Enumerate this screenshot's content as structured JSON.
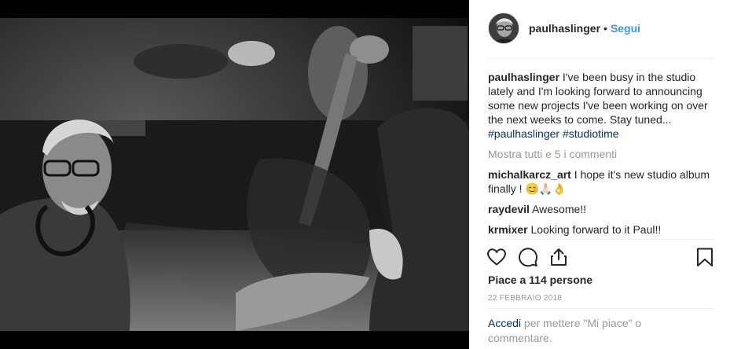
{
  "post": {
    "username": "paulhaslinger",
    "separator": "•",
    "follow_label": "Segui",
    "caption": {
      "username": "paulhaslinger",
      "text": " I've been busy in the studio lately and I'm looking forward to announcing some new projects I've been working on over the next weeks to come. Stay tuned... ",
      "hashtag1": "#paulhaslinger",
      "hashtag2": "#studiotime"
    },
    "show_all_comments": "Mostra tutti e 5 i commenti",
    "comments": [
      {
        "username": "michalkarcz_art",
        "text": " I hope it's new studio album finally ! 😊🙏🏻👌"
      },
      {
        "username": "raydevil",
        "text": " Awesome!!"
      },
      {
        "username": "krmixer",
        "text": " Looking forward to it Paul!!"
      }
    ],
    "likes_text": "Piace a 114 persone",
    "date": "22 FEBBRAIO 2018",
    "login_link": "Accedi",
    "login_text": " per mettere \"Mi piace\" o commentare."
  },
  "icons": {
    "heart": "heart-icon",
    "comment": "comment-icon",
    "share": "share-icon",
    "save": "bookmark-icon"
  },
  "colors": {
    "link_blue": "#3897f0",
    "hashtag_navy": "#003569",
    "muted_gray": "#999999",
    "divider": "#efefef"
  }
}
